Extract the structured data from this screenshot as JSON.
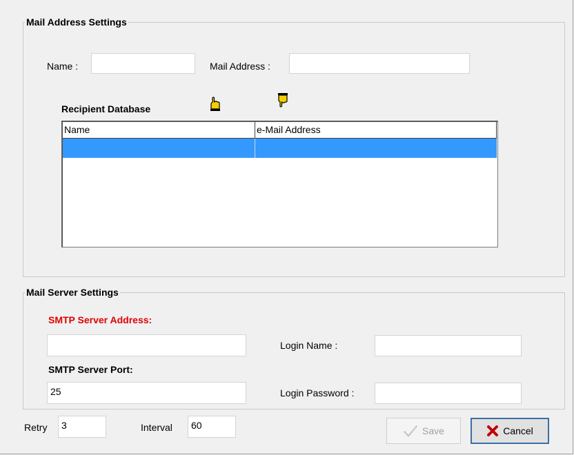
{
  "mail_address": {
    "legend": "Mail Address Settings",
    "name_label": "Name :",
    "name_value": "",
    "mail_label": "Mail Address :",
    "mail_value": "",
    "db_title": "Recipient Database",
    "columns": [
      "Name",
      "e-Mail Address"
    ],
    "icons": {
      "add": "hand-up-icon",
      "remove": "hand-down-icon"
    }
  },
  "mail_server": {
    "legend": "Mail Server Settings",
    "smtp_address_label": "SMTP Server Address:",
    "smtp_address_value": "",
    "smtp_port_label": "SMTP Server Port:",
    "smtp_port_value": "25",
    "login_name_label": "Login Name :",
    "login_name_value": "",
    "login_password_label": "Login Password :",
    "login_password_value": ""
  },
  "footer": {
    "retry_label": "Retry",
    "retry_value": "3",
    "interval_label": "Interval",
    "interval_value": "60",
    "save_label": "Save",
    "cancel_label": "Cancel"
  },
  "colors": {
    "selection": "#3399ff",
    "required": "#e00000",
    "cancel_x": "#c00000"
  }
}
